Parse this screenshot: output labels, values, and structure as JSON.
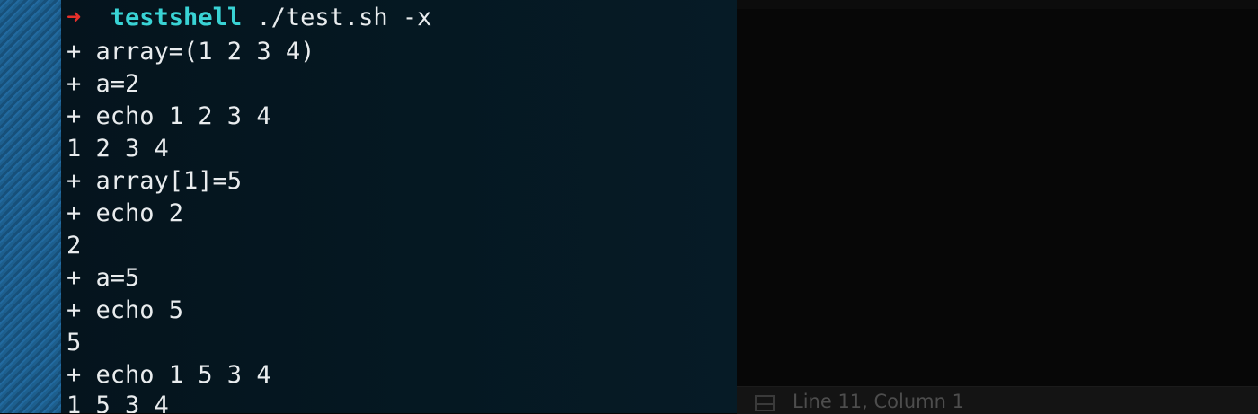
{
  "terminal": {
    "prompt": {
      "arrow": "➜",
      "directory": "testshell",
      "command": "./test.sh -x"
    },
    "output_lines": [
      "+ array=(1 2 3 4)",
      "+ a=2",
      "+ echo 1 2 3 4",
      "1 2 3 4",
      "+ array[1]=5",
      "+ echo 2",
      "2",
      "+ a=5",
      "+ echo 5",
      "5",
      "+ echo 1 5 3 4",
      "1 5 3 4"
    ]
  },
  "editor": {
    "status_bar": {
      "panel_toggle_icon": "panel-toggle-icon",
      "cursor_position": "Line 11, Column 1"
    }
  },
  "colors": {
    "prompt_arrow": "#e4302b",
    "prompt_directory": "#39d3d5",
    "terminal_text": "#e9ecee",
    "terminal_background": "#05161f",
    "editor_background": "#070707",
    "status_text": "#4d4d4d"
  }
}
